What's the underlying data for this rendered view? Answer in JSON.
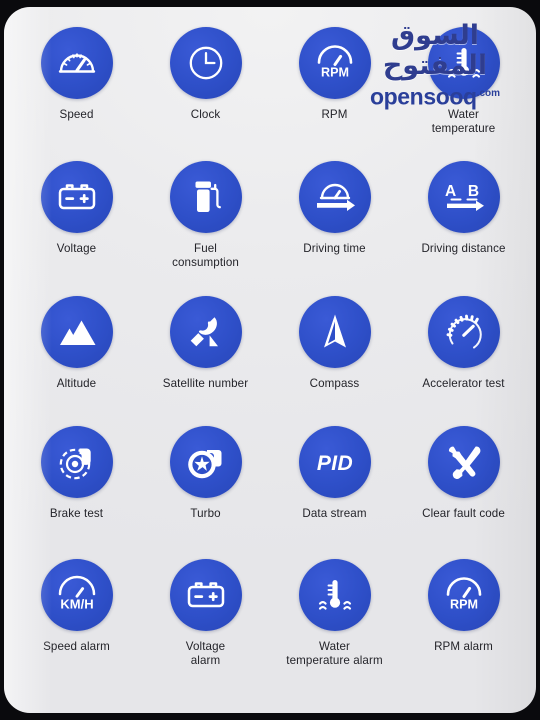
{
  "theme": {
    "badge_blue": "#2E4FC8",
    "panel_background": "#E8E8EA",
    "bezel": "#0A0A0D",
    "label_color": "#24242A",
    "icon_color": "#FFFFFF"
  },
  "watermark": {
    "arabic": "السوق المفتوح",
    "latin": "opensooq",
    "tld": ".com"
  },
  "grid": {
    "columns": 4,
    "rows": 5,
    "items": [
      {
        "label": "Speed",
        "icon": "speedometer-icon"
      },
      {
        "label": "Clock",
        "icon": "clock-icon"
      },
      {
        "label": "RPM",
        "icon": "rpm-gauge-icon",
        "icon_text": "RPM"
      },
      {
        "label": "Water\ntemperature",
        "icon": "water-temperature-icon"
      },
      {
        "label": "Voltage",
        "icon": "battery-icon",
        "icon_text": "- +"
      },
      {
        "label": "Fuel\nconsumption",
        "icon": "fuel-pump-icon"
      },
      {
        "label": "Driving time",
        "icon": "driving-time-icon"
      },
      {
        "label": "Driving distance",
        "icon": "driving-distance-icon",
        "icon_text": "A B"
      },
      {
        "label": "Altitude",
        "icon": "mountain-icon"
      },
      {
        "label": "Satellite number",
        "icon": "satellite-dish-icon"
      },
      {
        "label": "Compass",
        "icon": "compass-needle-icon"
      },
      {
        "label": "Accelerator test",
        "icon": "accelerator-gauge-icon"
      },
      {
        "label": "Brake test",
        "icon": "brake-disc-icon"
      },
      {
        "label": "Turbo",
        "icon": "turbocharger-icon"
      },
      {
        "label": "Data stream",
        "icon": "pid-icon",
        "icon_text": "PID"
      },
      {
        "label": "Clear fault code",
        "icon": "wrench-spanner-icon"
      },
      {
        "label": "Speed alarm",
        "icon": "speed-alarm-icon",
        "icon_text": "KM/H"
      },
      {
        "label": "Voltage\nalarm",
        "icon": "battery-icon",
        "icon_text": "- +"
      },
      {
        "label": "Water\ntemperature alarm",
        "icon": "water-temperature-icon"
      },
      {
        "label": "RPM alarm",
        "icon": "rpm-gauge-icon",
        "icon_text": "RPM"
      }
    ]
  }
}
